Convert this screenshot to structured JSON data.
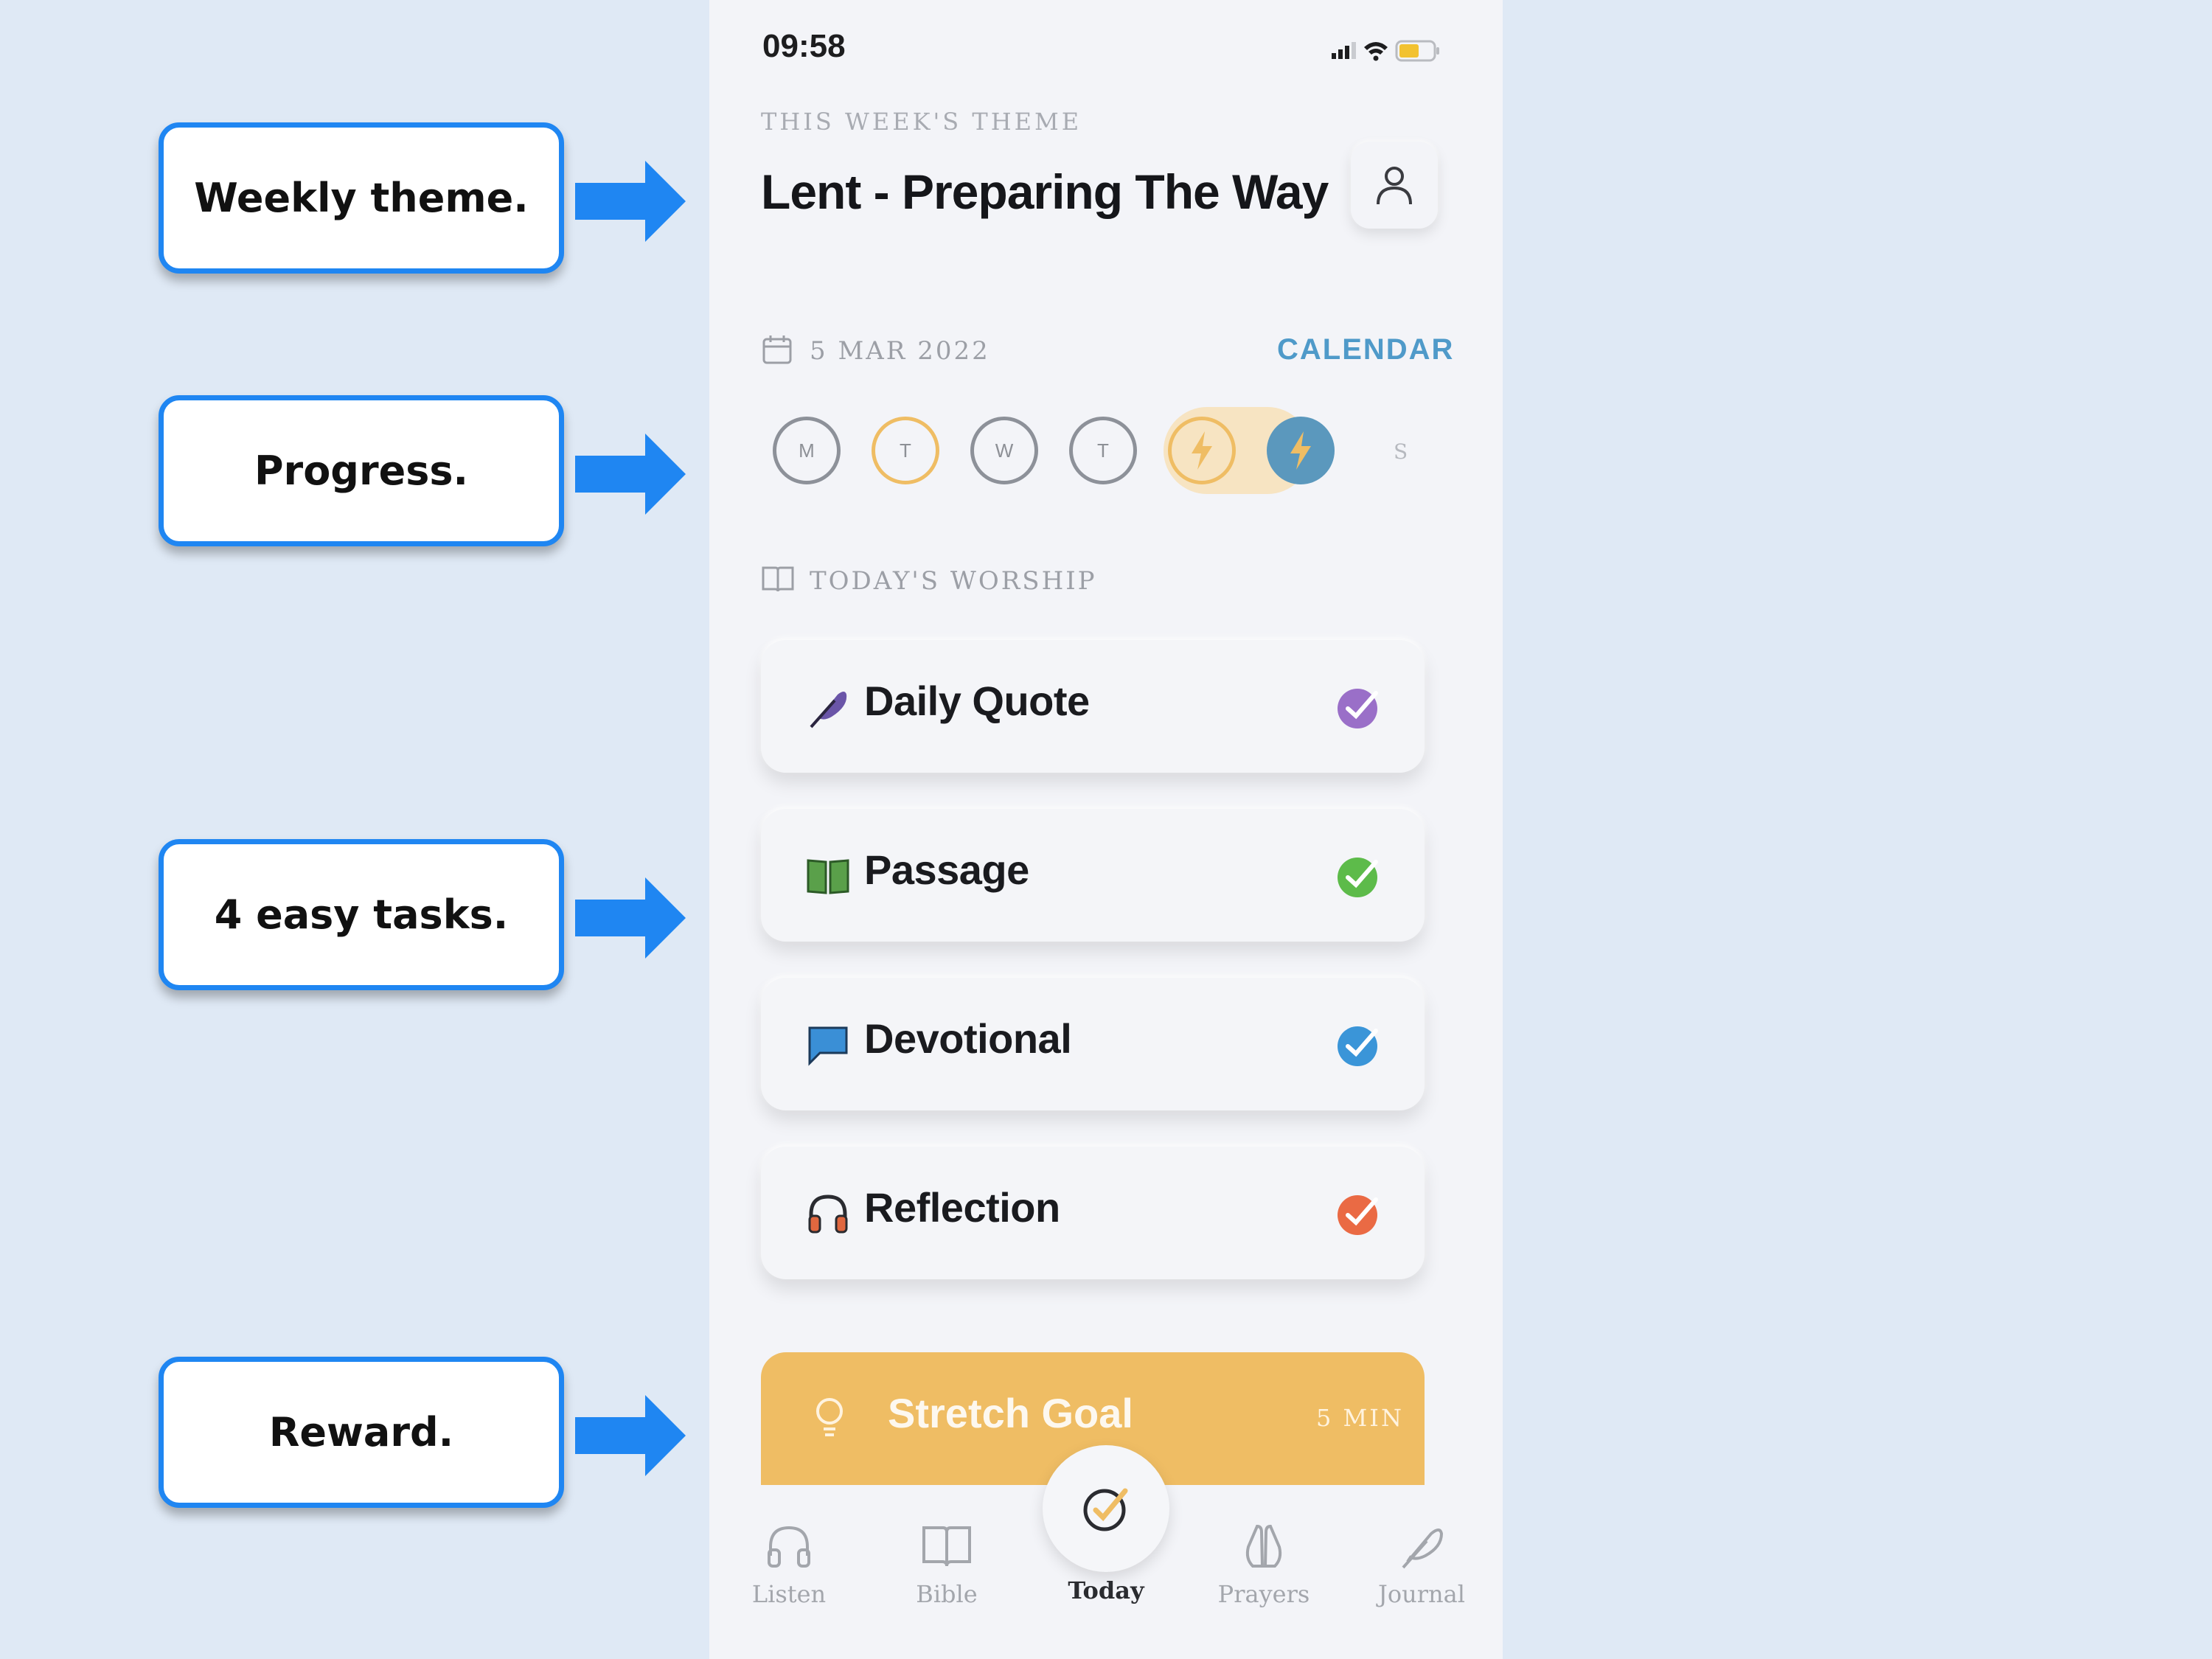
{
  "callouts": {
    "weekly_theme": "Weekly theme.",
    "progress": "Progress.",
    "tasks": "4 easy tasks.",
    "reward": "Reward."
  },
  "status_bar": {
    "time": "09:58"
  },
  "header": {
    "theme_label": "THIS WEEK'S THEME",
    "theme_title": "Lent - Preparing The Way"
  },
  "date_row": {
    "date": "5 MAR 2022",
    "calendar_link": "CALENDAR"
  },
  "week_progress": {
    "days": [
      "M",
      "T",
      "W",
      "T"
    ],
    "streak_days": 2,
    "next_day": "S"
  },
  "worship": {
    "label": "TODAY'S WORSHIP",
    "tasks": [
      {
        "label": "Daily Quote",
        "icon": "feather-icon",
        "color": "#9a6fc8",
        "completed": true
      },
      {
        "label": "Passage",
        "icon": "book-icon",
        "color": "#5dbb4a",
        "completed": true
      },
      {
        "label": "Devotional",
        "icon": "chat-icon",
        "color": "#3a95d8",
        "completed": true
      },
      {
        "label": "Reflection",
        "icon": "headphones-icon",
        "color": "#ea6a44",
        "completed": true
      }
    ]
  },
  "stretch_goal": {
    "label": "Stretch Goal",
    "duration": "5 MIN",
    "color": "#efbd64"
  },
  "tabbar": {
    "tabs": [
      {
        "label": "Listen",
        "icon": "headphones-icon"
      },
      {
        "label": "Bible",
        "icon": "book-icon"
      },
      {
        "label": "Today",
        "icon": "check-circle-icon"
      },
      {
        "label": "Prayers",
        "icon": "praying-hands-icon"
      },
      {
        "label": "Journal",
        "icon": "feather-icon"
      }
    ]
  },
  "colors": {
    "accent_blue": "#4f9ac9",
    "streak_orange": "#efbd64",
    "callout_blue": "#1f86f2"
  }
}
